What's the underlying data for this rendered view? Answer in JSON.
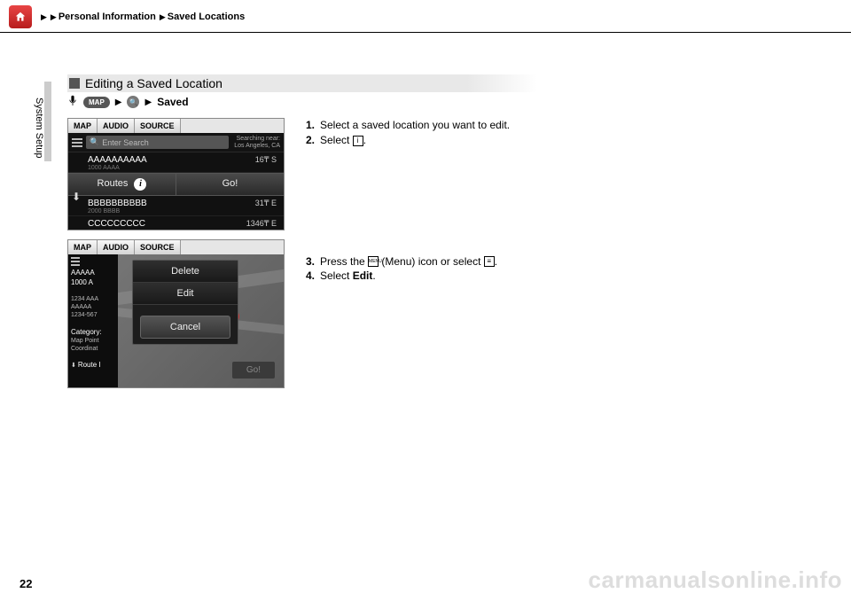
{
  "header": {
    "breadcrumb1": "Personal Information",
    "breadcrumb2": "Saved Locations"
  },
  "side_tab": "System Setup",
  "section_title": "Editing a Saved Location",
  "trail": {
    "map_label": "MAP",
    "saved": "Saved"
  },
  "fig1": {
    "tabs": {
      "map": "MAP",
      "audio": "AUDIO",
      "source": "SOURCE"
    },
    "search_placeholder": "Enter Search",
    "near_label": "Searching near:",
    "near_city": "Los Angeles, CA",
    "rows": [
      {
        "name": "AAAAAAAAAA",
        "sub": "1000 AAAA",
        "dist": "16₸  S"
      },
      {
        "name": "BBBBBBBBBB",
        "sub": "2000 BBBB",
        "dist": "31₸  E"
      },
      {
        "name": "CCCCCCCCC",
        "sub": "",
        "dist": "1346₸  E"
      }
    ],
    "routes": "Routes",
    "go": "Go!"
  },
  "fig2": {
    "tabs": {
      "map": "MAP",
      "audio": "AUDIO",
      "source": "SOURCE"
    },
    "left": {
      "name": "AAAAA",
      "addr1": "1000 A",
      "addr2": "1234 AAA",
      "addr3": "AAAAA",
      "phone": "1234-567",
      "cat": "Category:",
      "mp": "Map Point",
      "coord": "Coordinat",
      "route": "Route I"
    },
    "popup": {
      "delete": "Delete",
      "edit": "Edit",
      "cancel": "Cancel"
    },
    "go": "Go!"
  },
  "steps_a": [
    {
      "n": "1.",
      "t": "Select a saved location you want to edit."
    },
    {
      "n": "2.",
      "t_pre": "Select ",
      "icon": "info",
      "t_post": "."
    }
  ],
  "steps_b": [
    {
      "n": "3.",
      "t_pre": "Press the ",
      "icon": "menu",
      "t_mid": " (Menu) icon or select ",
      "icon2": "list",
      "t_post": "."
    },
    {
      "n": "4.",
      "t_pre": "Select ",
      "bold": "Edit",
      "t_post": "."
    }
  ],
  "page_number": "22",
  "watermark": "carmanualsonline.info"
}
